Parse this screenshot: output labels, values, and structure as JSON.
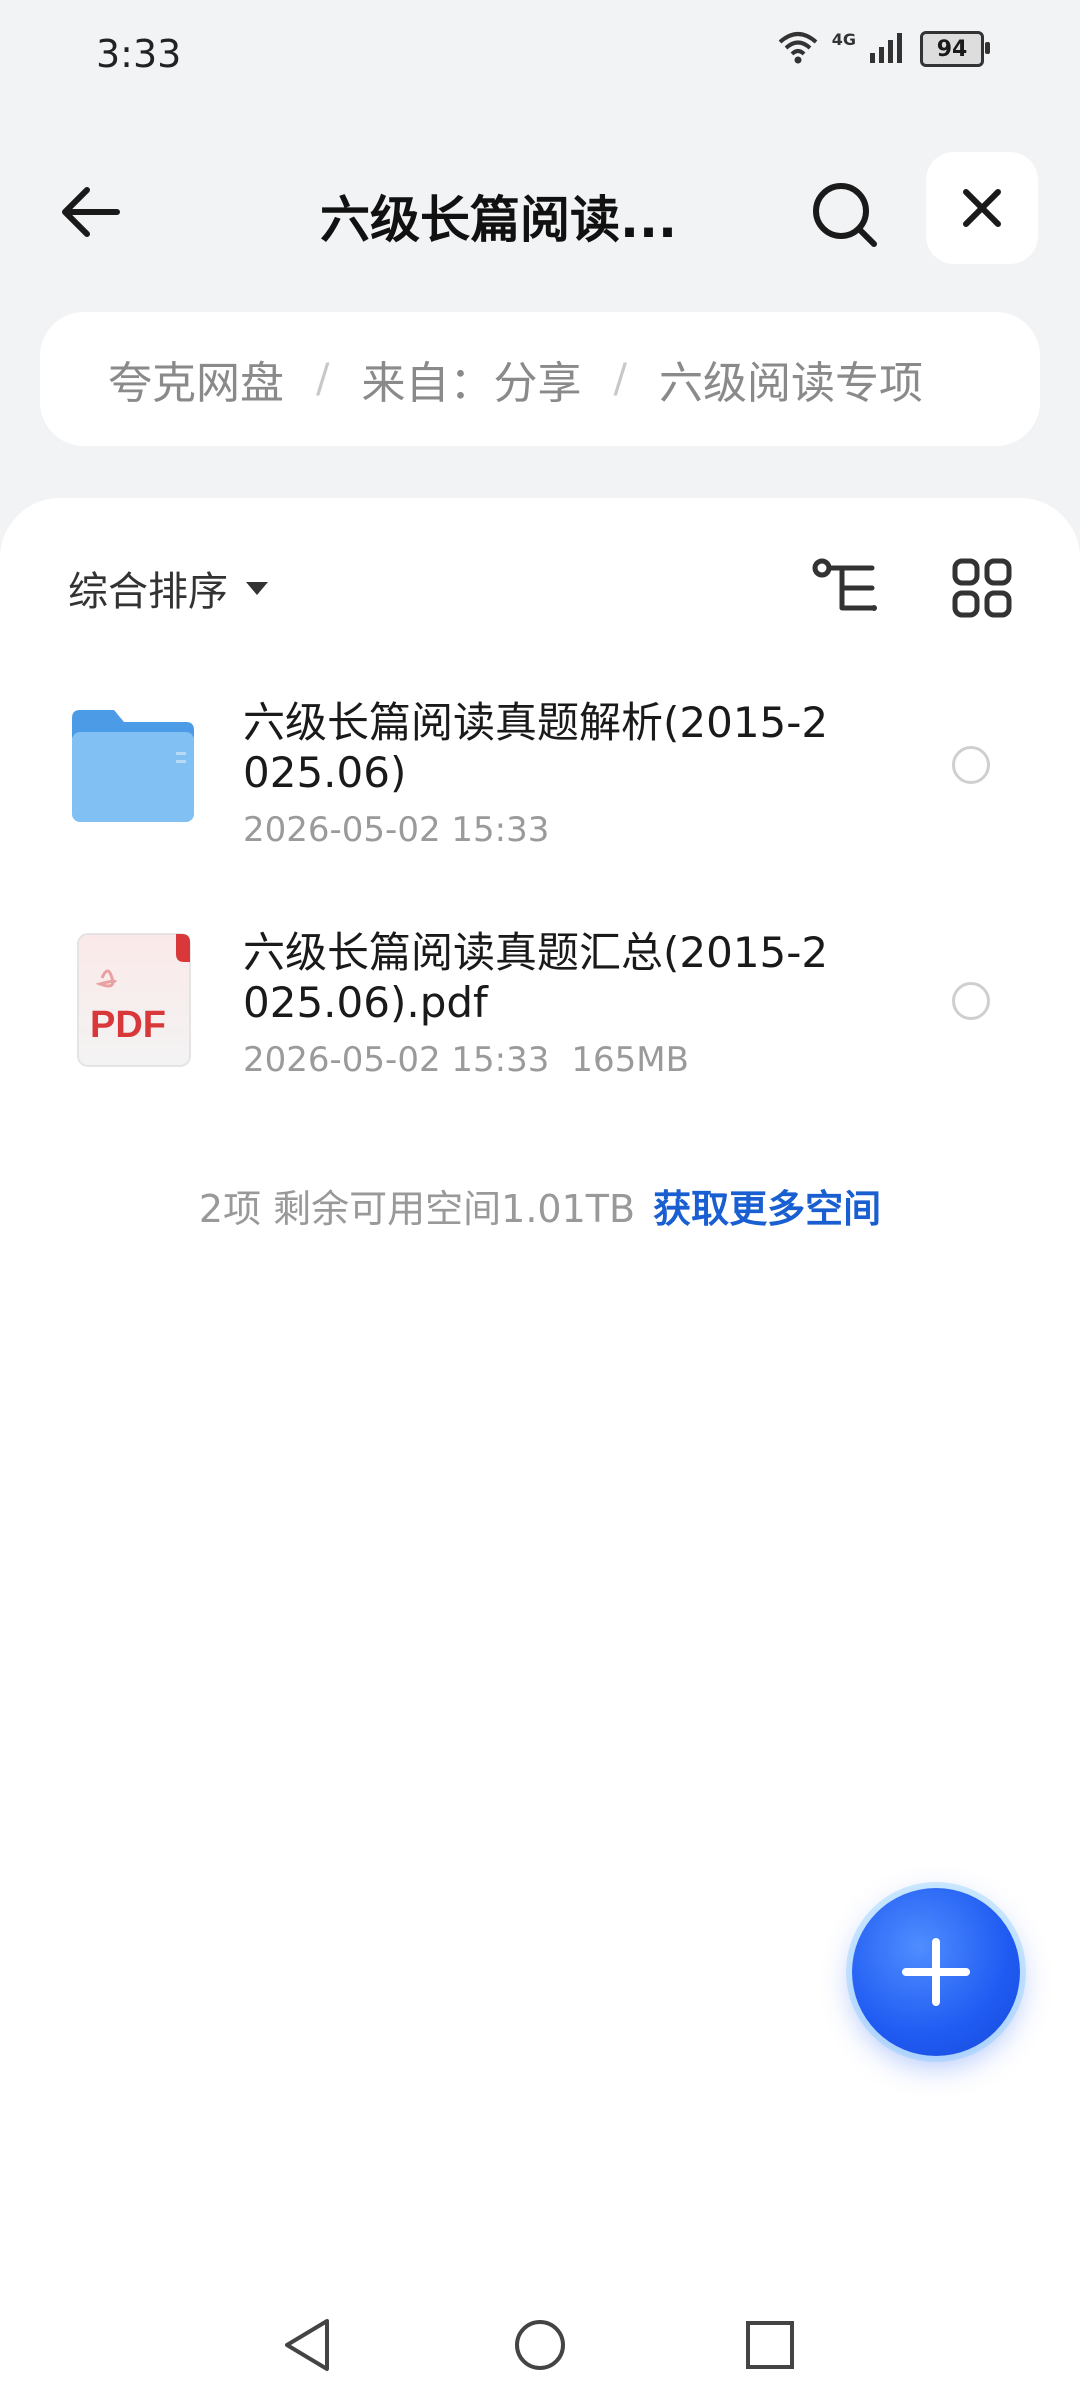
{
  "status_bar": {
    "time": "3:33",
    "network": "4G",
    "battery": "94"
  },
  "header": {
    "title": "六级长篇阅读..."
  },
  "breadcrumb": {
    "items": [
      "夸克网盘",
      "来自：分享",
      "六级阅读专项"
    ],
    "separator": "/"
  },
  "toolbar": {
    "sort_label": "综合排序"
  },
  "files": [
    {
      "type": "folder",
      "name": "六级长篇阅读真题解析(2015-2025.06)",
      "date": "2026-05-02 15:33",
      "size": ""
    },
    {
      "type": "pdf",
      "name": "六级长篇阅读真题汇总(2015-2025.06).pdf",
      "date": "2026-05-02 15:33",
      "size": "165MB",
      "icon_label": "PDF"
    }
  ],
  "footer": {
    "summary": "2项 剩余可用空间1.01TB",
    "link": "获取更多空间"
  },
  "colors": {
    "accent": "#1a5fd1",
    "fab": "#1f5bf2",
    "folder": "#6fb3f0",
    "pdf": "#d9383a"
  }
}
